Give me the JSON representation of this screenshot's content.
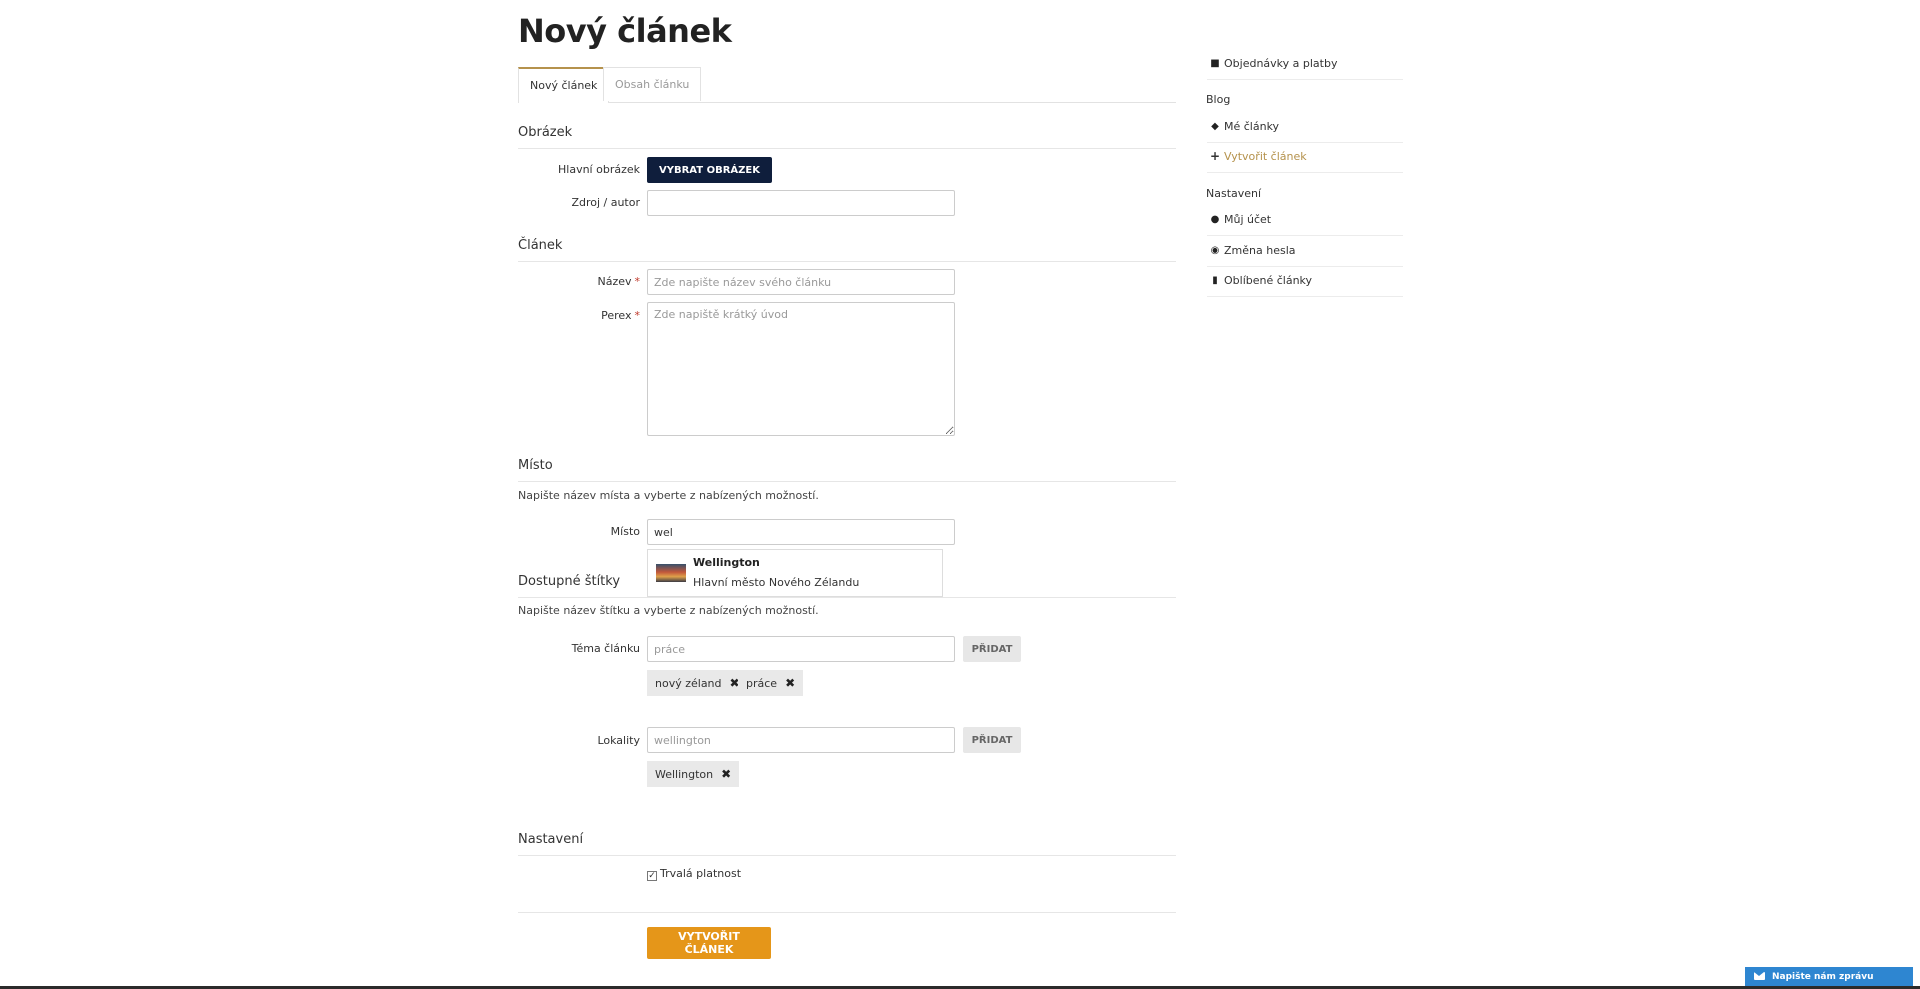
{
  "page_title": "Nový článek",
  "tabs": [
    {
      "label": "Nový článek",
      "active": true
    },
    {
      "label": "Obsah článku",
      "active": false
    }
  ],
  "sections": {
    "image": {
      "heading": "Obrázek",
      "main_image_label": "Hlavní obrázek",
      "choose_button": "VYBRAT OBRÁZEK",
      "source_label": "Zdroj / autor",
      "source_value": ""
    },
    "article": {
      "heading": "Článek",
      "title_label": "Název",
      "title_placeholder": "Zde napište název svého článku",
      "perex_label": "Perex",
      "perex_placeholder": "Zde napiště krátký úvod",
      "required_mark": "*"
    },
    "place": {
      "heading": "Místo",
      "help": "Napište název místa a vyberte z nabízených možností.",
      "label": "Místo",
      "value": "wel",
      "suggestion": {
        "title": "Wellington",
        "subtitle": "Hlavní město Nového Zélandu"
      }
    },
    "tags": {
      "heading": "Dostupné štítky",
      "help": "Napište název štítku a vyberte z nabízených možností.",
      "topic_label": "Téma článku",
      "topic_placeholder": "práce",
      "add_button": "PŘIDAT",
      "topic_tags": [
        "nový zéland",
        "práce"
      ],
      "localities_label": "Lokality",
      "localities_placeholder": "wellington",
      "locality_tags": [
        "Wellington"
      ],
      "remove_glyph": "✖"
    },
    "settings": {
      "heading": "Nastavení",
      "permanent_label": "Trvalá platnost",
      "permanent_checked": true
    }
  },
  "submit_button": "VYTVOŘIT ČLÁNEK",
  "sidebar": {
    "top_item": {
      "label": "Objednávky a platby",
      "icon": "briefcase-icon"
    },
    "blog_heading": "Blog",
    "blog_items": [
      {
        "label": "Mé články",
        "icon": "tags-icon",
        "active": false
      },
      {
        "label": "Vytvořit článek",
        "icon": "plus-icon",
        "active": true
      }
    ],
    "settings_heading": "Nastavení",
    "settings_items": [
      {
        "label": "Můj účet",
        "icon": "user-icon"
      },
      {
        "label": "Změna hesla",
        "icon": "cog-icon"
      },
      {
        "label": "Oblíbené články",
        "icon": "bookmark-icon"
      }
    ]
  },
  "chat_widget": {
    "label": "Napište nám zprávu",
    "icon": "envelope-icon",
    "color": "#2e86d1"
  },
  "colors": {
    "accent_gold": "#b5924c",
    "primary_dark": "#0f1e3c",
    "submit_orange": "#e59619"
  }
}
